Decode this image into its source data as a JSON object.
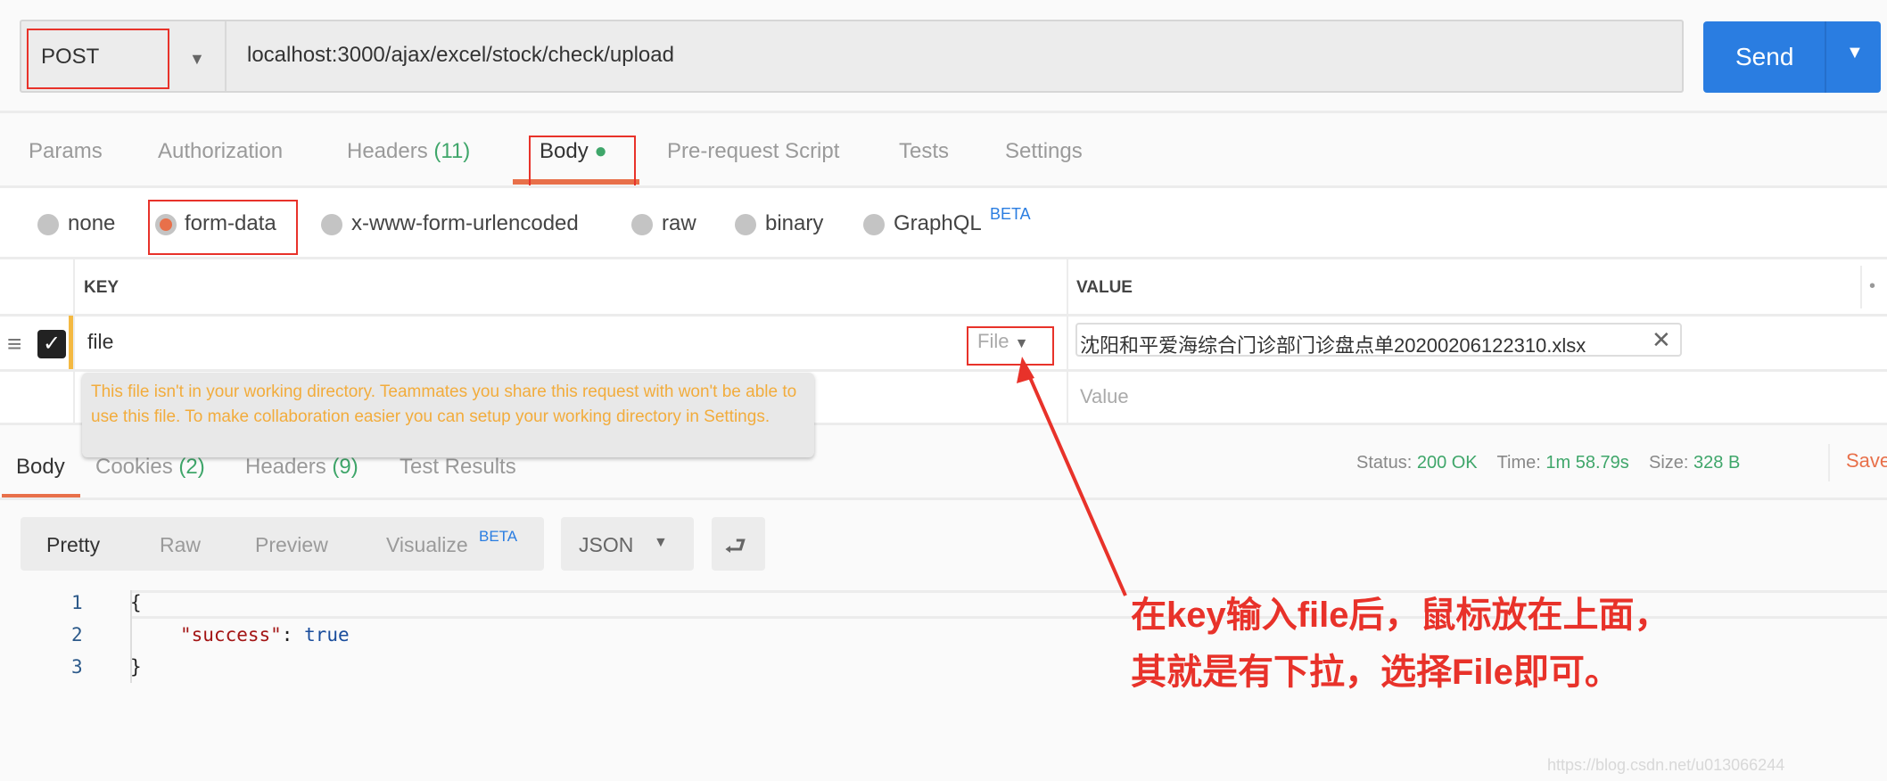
{
  "request": {
    "method": "POST",
    "url": "localhost:3000/ajax/excel/stock/check/upload",
    "send_label": "Send"
  },
  "request_tabs": [
    {
      "label": "Params"
    },
    {
      "label": "Authorization"
    },
    {
      "label": "Headers",
      "count": "(11)"
    },
    {
      "label": "Body",
      "active": true
    },
    {
      "label": "Pre-request Script"
    },
    {
      "label": "Tests"
    },
    {
      "label": "Settings"
    }
  ],
  "body_types": [
    {
      "label": "none"
    },
    {
      "label": "form-data",
      "selected": true
    },
    {
      "label": "x-www-form-urlencoded"
    },
    {
      "label": "raw"
    },
    {
      "label": "binary"
    },
    {
      "label": "GraphQL",
      "badge": "BETA"
    }
  ],
  "table": {
    "headers": {
      "key": "KEY",
      "value": "VALUE"
    },
    "rows": [
      {
        "key": "file",
        "type": "File",
        "value": "沈阳和平爱海综合门诊部门诊盘点单20200206122310.xlsx",
        "checked": true
      }
    ],
    "new_value_placeholder": "Value"
  },
  "tooltip": "This file isn't in your working directory. Teammates you share this request with won't be able to use this file. To make collaboration easier you can setup your working directory in Settings.",
  "response_tabs": [
    {
      "label": "Body"
    },
    {
      "label": "Cookies",
      "count": "(2)"
    },
    {
      "label": "Headers",
      "count": "(9)"
    },
    {
      "label": "Test Results"
    }
  ],
  "status": {
    "status_label": "Status:",
    "status": "200 OK",
    "time_label": "Time:",
    "time": "1m 58.79s",
    "size_label": "Size:",
    "size": "328 B",
    "save": "Save"
  },
  "format": {
    "pretty": "Pretty",
    "raw": "Raw",
    "preview": "Preview",
    "visualize": "Visualize",
    "beta": "BETA",
    "lang": "JSON"
  },
  "code": {
    "lines": [
      "1",
      "2",
      "3"
    ],
    "l1": "{",
    "key": "\"success\"",
    "colon": ": ",
    "val": "true",
    "l3": "}"
  },
  "annotation": {
    "line1": "在key输入file后，鼠标放在上面，",
    "line2": "其就是有下拉，选择File即可。"
  },
  "watermark": "https://blog.csdn.net/u013066244",
  "colors": {
    "accent": "#e8704a",
    "send": "#2a7de1",
    "green": "#3fa66a",
    "annotation": "#e8322a",
    "warning": "#f2ac3c"
  }
}
